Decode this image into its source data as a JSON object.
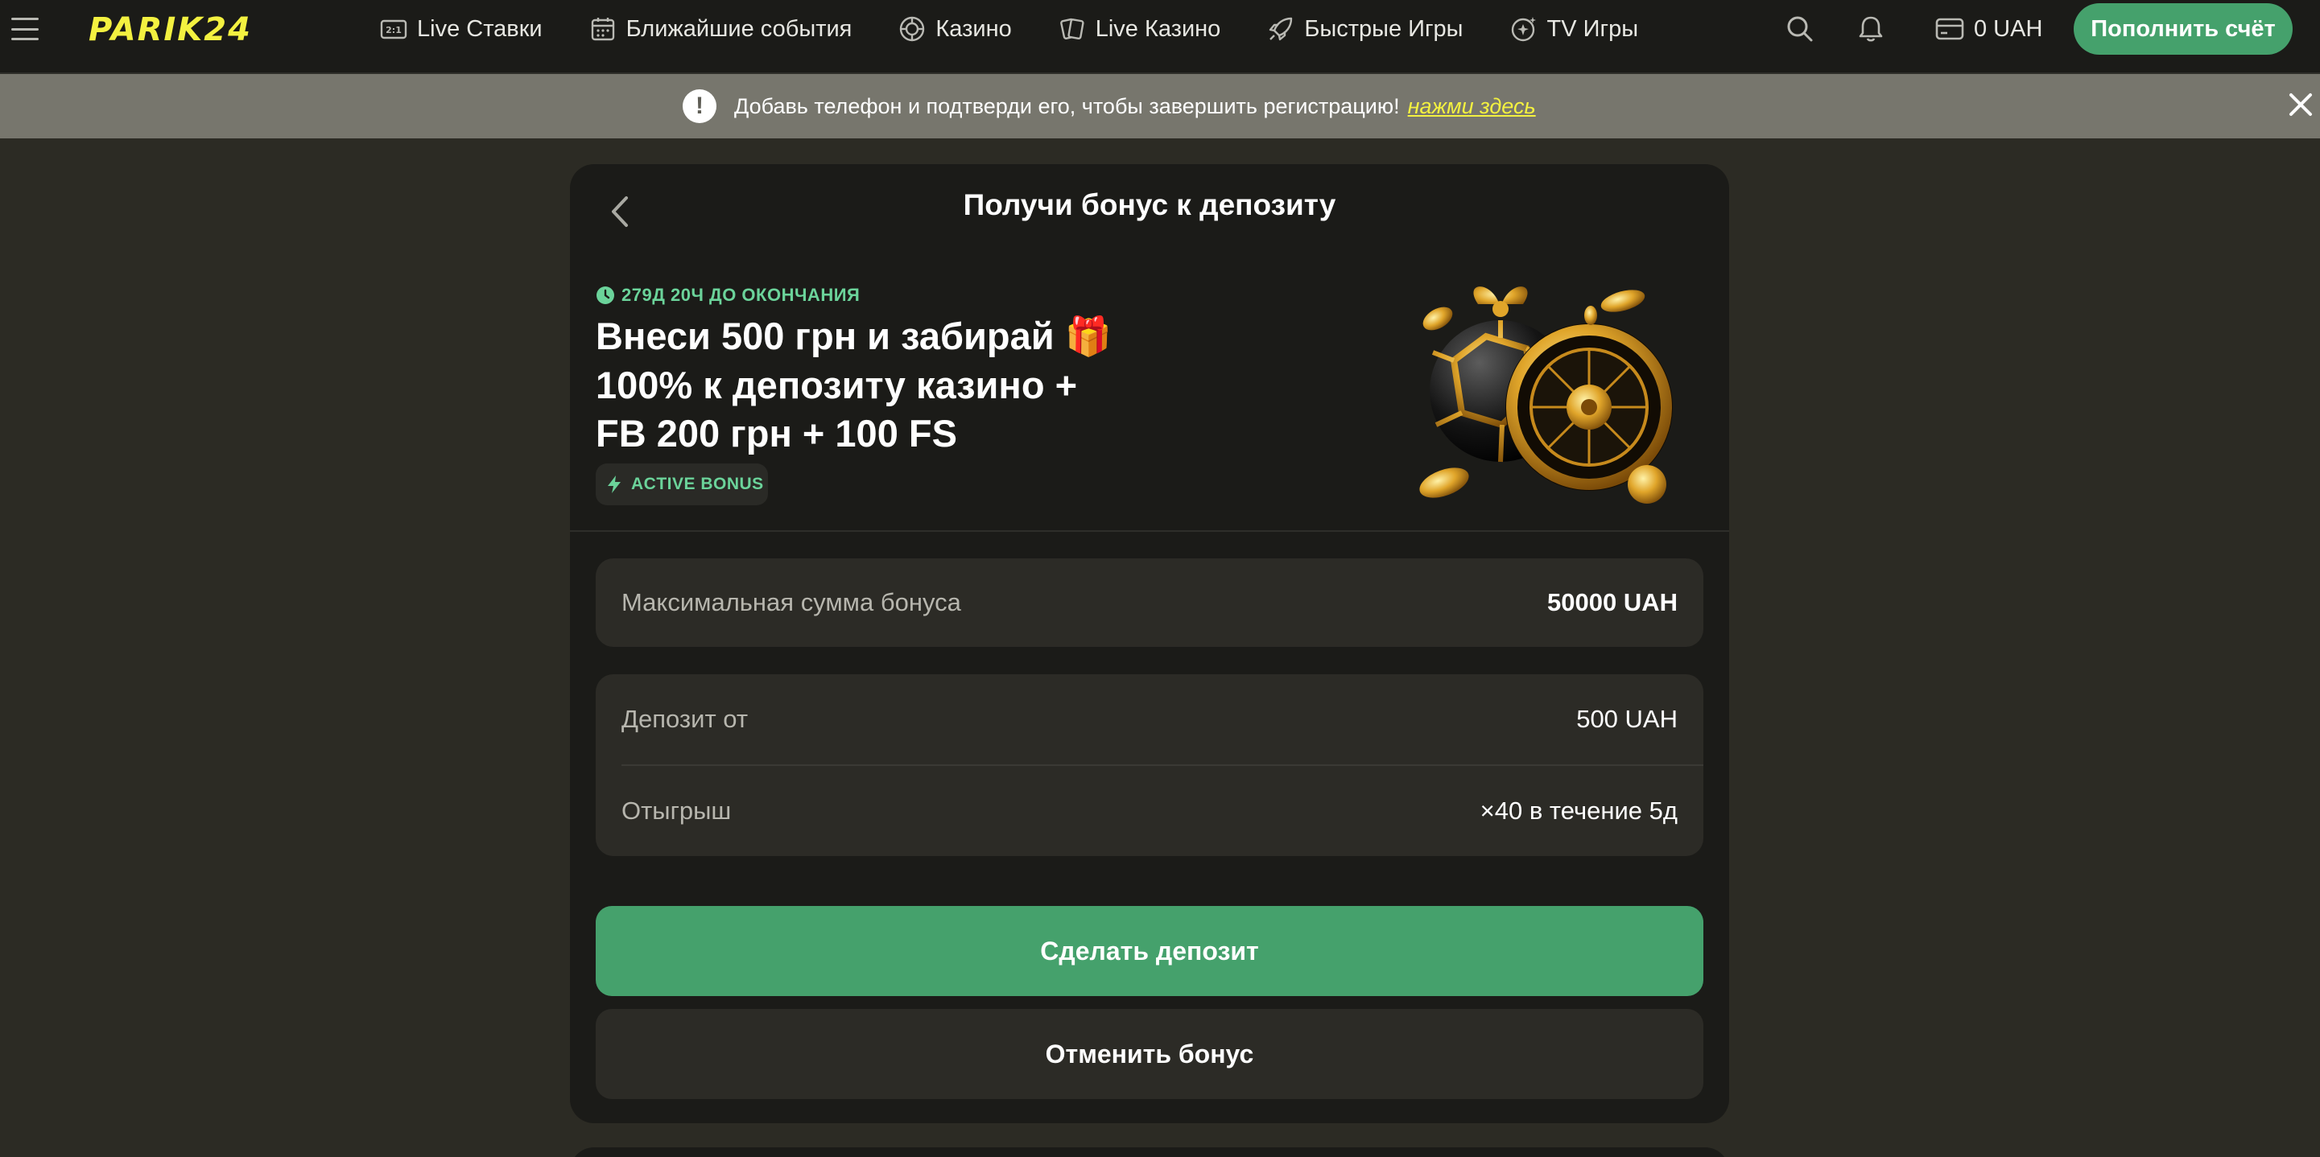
{
  "header": {
    "logo": "PARIK24",
    "nav": [
      {
        "label": "Live Ставки",
        "icon": "live-bets-icon"
      },
      {
        "label": "Ближайшие события",
        "icon": "calendar-icon"
      },
      {
        "label": "Казино",
        "icon": "casino-chip-icon"
      },
      {
        "label": "Live Казино",
        "icon": "cards-icon"
      },
      {
        "label": "Быстрые Игры",
        "icon": "rocket-icon"
      },
      {
        "label": "TV Игры",
        "icon": "tv-games-icon"
      }
    ],
    "balance": "0 UAH",
    "topup_label": "Пополнить счёт"
  },
  "notice": {
    "text": "Добавь телефон и подтверди его, чтобы завершить регистрацию!",
    "link": "нажми здесь"
  },
  "card": {
    "title": "Получи бонус к депозиту",
    "timer": "279Д 20Ч ДО ОКОНЧАНИЯ",
    "promo_title": "Внеси 500 грн и забирай",
    "promo_title_emoji": "🎁",
    "promo_title_rest": "100% к депозиту казино + FB 200 грн + 100 FS",
    "badge": "ACTIVE BONUS",
    "max_bonus": {
      "label": "Максимальная сумма бонуса",
      "value": "50000 UAH"
    },
    "deposit_from": {
      "label": "Депозит от",
      "value": "500 UAH"
    },
    "wager": {
      "label": "Отыгрыш",
      "value": "×40 в течение 5д"
    },
    "primary_button": "Сделать депозит",
    "secondary_button": "Отменить бонус"
  },
  "colors": {
    "accent_green": "#45a16c",
    "brand_yellow": "#f3f140",
    "status_green": "#6bd39a",
    "background": "#2c2b24",
    "card_bg": "#1b1b18"
  }
}
